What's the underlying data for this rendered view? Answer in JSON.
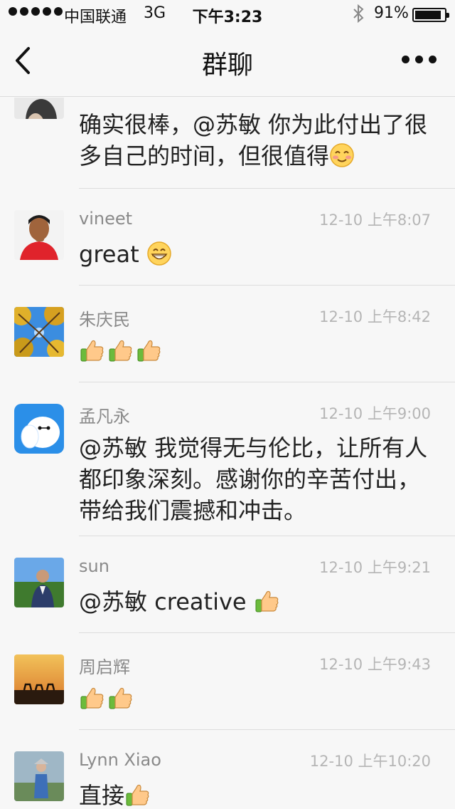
{
  "status_bar": {
    "carrier": "中国联通",
    "network": "3G",
    "time": "下午3:23",
    "battery": "91%",
    "battery_level": 0.91
  },
  "nav": {
    "title": "群聊"
  },
  "messages": [
    {
      "name": "",
      "time": "",
      "text": "确实很棒，@苏敏 你为此付出了很多自己的时间，但很值得",
      "emoji": "blush-emoji"
    },
    {
      "name": "vineet",
      "time": "12-10 上午8:07",
      "text": "great",
      "emoji": "grin-emoji"
    },
    {
      "name": "朱庆民",
      "time": "12-10 上午8:42",
      "text": "",
      "thumbs": 3
    },
    {
      "name": "孟凡永",
      "time": "12-10 上午9:00",
      "text": "@苏敏 我觉得无与伦比，让所有人都印象深刻。感谢你的辛苦付出，带给我们震撼和冲击。"
    },
    {
      "name": "sun",
      "time": "12-10 上午9:21",
      "text": "@苏敏 creative",
      "thumbs": 1
    },
    {
      "name": "周启辉",
      "time": "12-10 上午9:43",
      "text": "",
      "thumbs": 2
    },
    {
      "name": "Lynn Xiao",
      "time": "12-10 上午10:20",
      "text": "直接",
      "thumbs": 1
    }
  ]
}
